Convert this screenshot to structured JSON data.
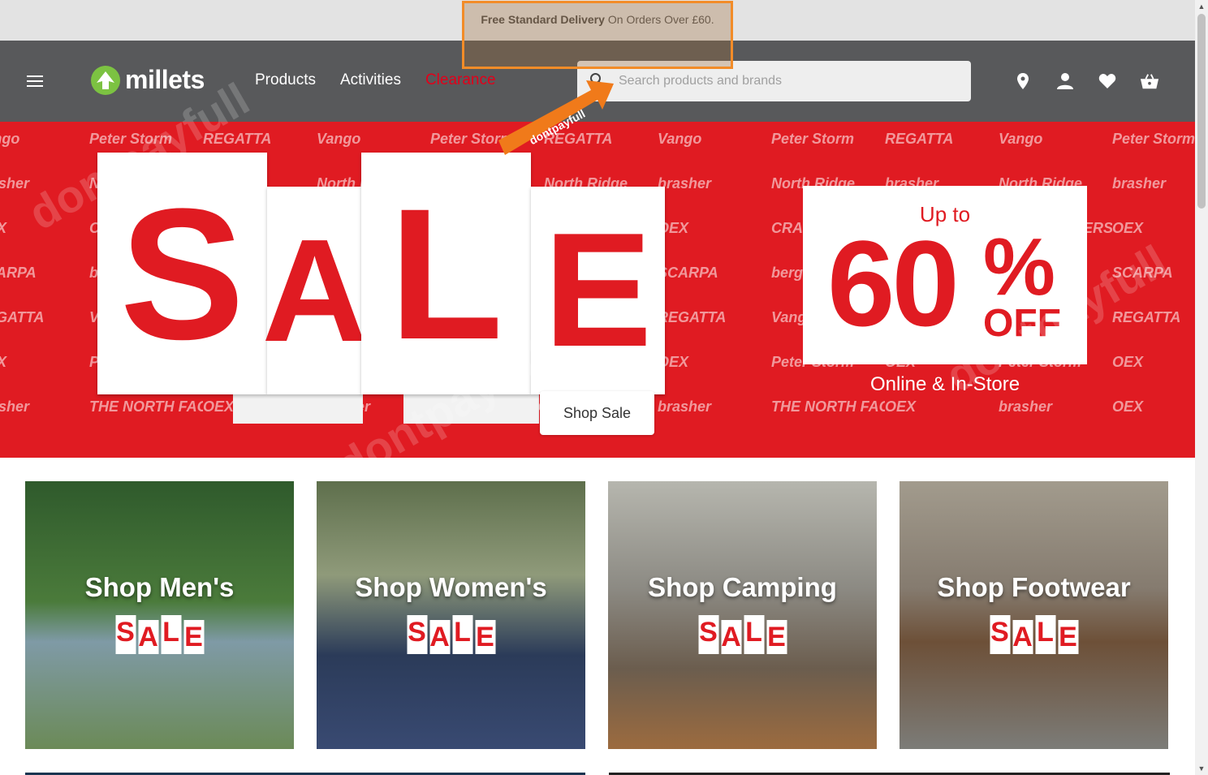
{
  "topbar": {
    "delivery_bold": "Free Standard Delivery",
    "delivery_rest": "On Orders Over £60."
  },
  "header": {
    "logo_text": "millets",
    "nav": [
      {
        "label": "Products"
      },
      {
        "label": "Activities"
      },
      {
        "label": "Clearance"
      }
    ],
    "search_placeholder": "Search products and brands",
    "icons": [
      "location-icon",
      "account-icon",
      "wishlist-icon",
      "basket-icon"
    ]
  },
  "overlay": {
    "arrow_label": "dontpayfull"
  },
  "hero": {
    "sale_letters": [
      "S",
      "A",
      "L",
      "E"
    ],
    "shop_button": "Shop Sale",
    "up_to": "Up to",
    "percent": "60",
    "percent_sign": "%",
    "off": "OFF",
    "subtitle": "Online & In-Store",
    "brands": [
      "Vango",
      "Peter Storm",
      "REGATTA",
      "Vango",
      "Peter Storm",
      "REGATTA",
      "Vango",
      "Peter Storm",
      "REGATTA",
      "Vango",
      "Peter Storm",
      "brasher",
      "North Ridge",
      "brasher",
      "North Ridge",
      "brasher",
      "North Ridge",
      "brasher",
      "North Ridge",
      "brasher",
      "North Ridge",
      "brasher",
      "OEX",
      "CRAGHOPPERS",
      "OEX",
      "CRAGHOPPERS",
      "OEX",
      "CRAGHOPPERS",
      "OEX",
      "CRAGHOPPERS",
      "OEX",
      "CRAGHOPPERS",
      "OEX",
      "SCARPA",
      "berghaus",
      "SCARPA",
      "berghaus",
      "SCARPA",
      "berghaus",
      "SCARPA",
      "berghaus",
      "SCARPA",
      "berghaus",
      "SCARPA",
      "REGATTA",
      "Vango",
      "REGATTA",
      "Vango",
      "REGATTA",
      "Vango",
      "REGATTA",
      "Vango",
      "REGATTA",
      "Vango",
      "REGATTA",
      "OEX",
      "Peter Storm",
      "OEX",
      "Peter Storm",
      "OEX",
      "Peter Storm",
      "OEX",
      "Peter Storm",
      "OEX",
      "Peter Storm",
      "OEX",
      "brasher",
      "THE NORTH FACE",
      "OEX",
      "brasher",
      "THE NORTH FACE",
      "OEX",
      "brasher",
      "THE NORTH FACE",
      "OEX",
      "brasher",
      "OEX"
    ]
  },
  "categories": [
    {
      "title": "Shop Men's",
      "sale": [
        "S",
        "A",
        "L",
        "E"
      ]
    },
    {
      "title": "Shop Women's",
      "sale": [
        "S",
        "A",
        "L",
        "E"
      ]
    },
    {
      "title": "Shop Camping",
      "sale": [
        "S",
        "A",
        "L",
        "E"
      ]
    },
    {
      "title": "Shop Footwear",
      "sale": [
        "S",
        "A",
        "L",
        "E"
      ]
    }
  ],
  "watermark_text": "dontpayfull",
  "colors": {
    "brand_red": "#e01b22",
    "header_grey": "#58595b",
    "logo_green": "#7cc242",
    "highlight_orange": "#f28c28"
  }
}
